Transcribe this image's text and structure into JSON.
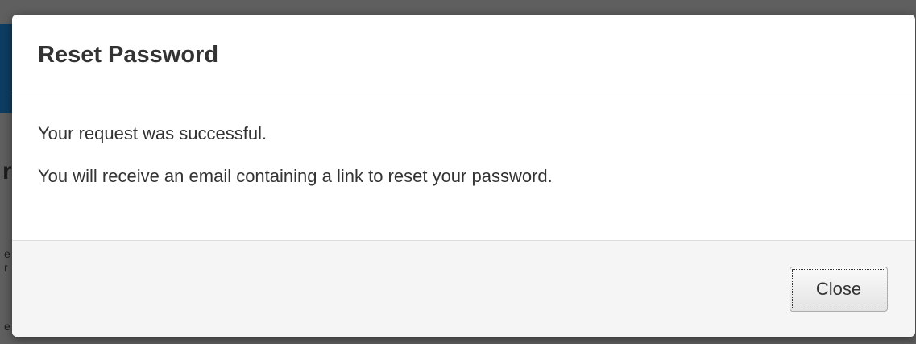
{
  "background_page": {
    "glyph_1": "r",
    "glyph_2": "e",
    "glyph_3": "r",
    "glyph_4": "e"
  },
  "dialog": {
    "title": "Reset Password",
    "messages": [
      "Your request was successful.",
      "You will receive an email containing a link to reset your password."
    ],
    "close_label": "Close"
  },
  "colors": {
    "overlay": "#5e5e5e",
    "dialog_background": "#ffffff",
    "footer_background": "#f5f5f5",
    "text": "#333333",
    "background_banner": "#0d3d63"
  }
}
